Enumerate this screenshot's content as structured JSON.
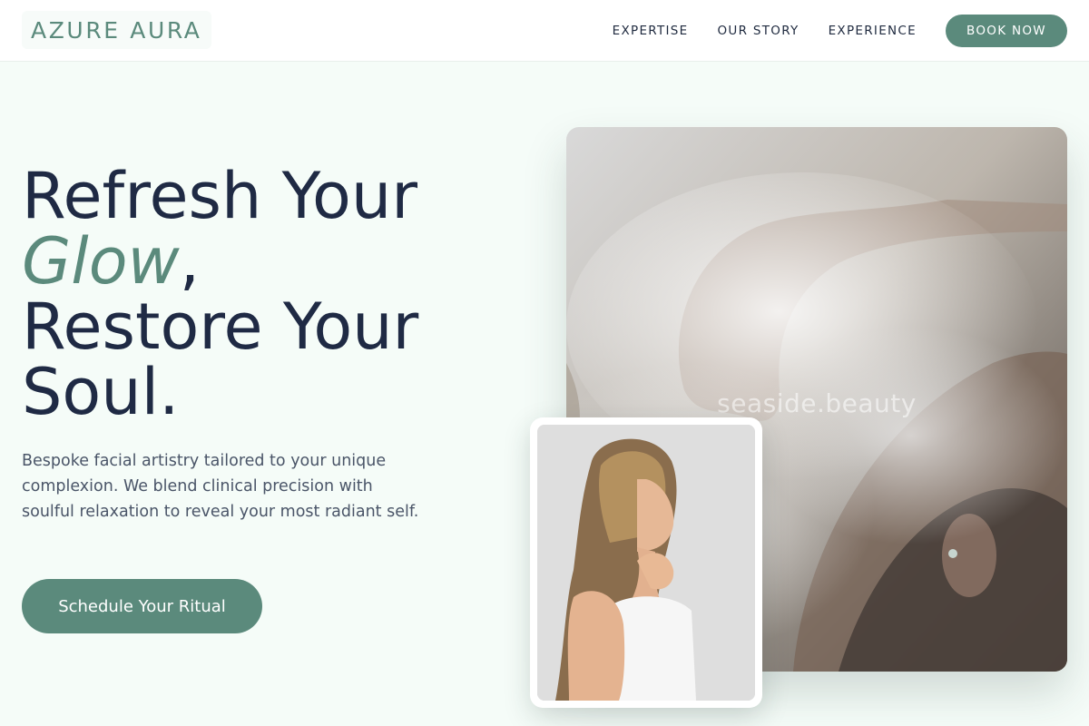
{
  "header": {
    "logo": "AZURE AURA",
    "nav": [
      {
        "label": "EXPERTISE"
      },
      {
        "label": "OUR STORY"
      },
      {
        "label": "EXPERIENCE"
      }
    ],
    "cta_label": "BOOK NOW"
  },
  "hero": {
    "title_line1": "Refresh Your",
    "title_accent": "Glow",
    "title_comma": ",",
    "title_line3": "Restore Your",
    "title_line4": "Soul.",
    "description": "Bespoke facial artistry tailored to your unique complexion. We blend clinical precision with soulful relaxation to reveal your most radiant self.",
    "cta_label": "Schedule Your Ritual"
  },
  "images": {
    "main_watermark": "seaside.beauty"
  },
  "colors": {
    "accent": "#5b8a7c",
    "heading": "#1f2a44",
    "body_text": "#4a5568",
    "page_background": "#f5fcf8"
  }
}
